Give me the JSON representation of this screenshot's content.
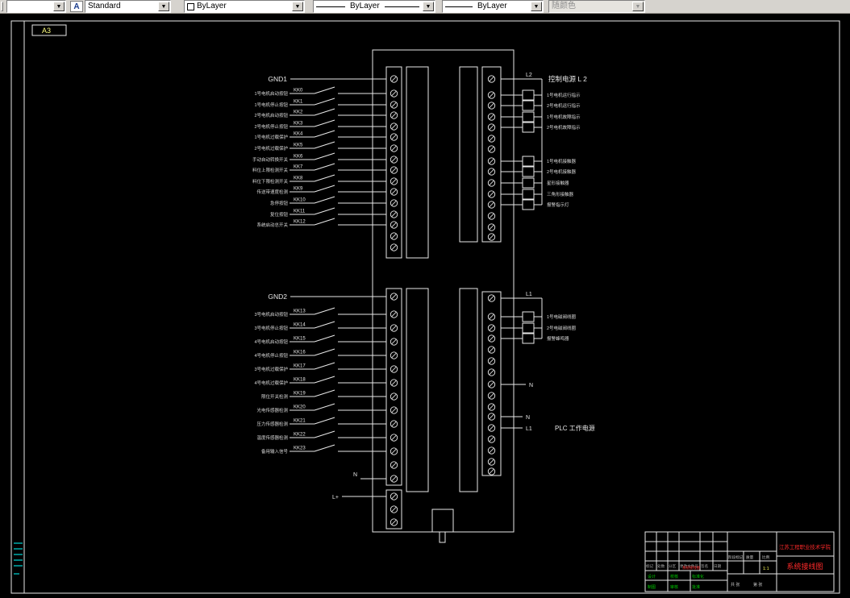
{
  "toolbar": {
    "layer_combo_value": "",
    "text_style_value": "Standard",
    "color_value": "ByLayer",
    "linetype_value": "ByLayer",
    "lineweight_value": "ByLayer",
    "plot_style_value": "随颜色"
  },
  "frame": {
    "format_label": "A3"
  },
  "diagram": {
    "gnd1_label": "GND1",
    "gnd2_label": "GND2",
    "l2_label": "L2",
    "l1_label": "L1",
    "n_label": "N",
    "lplus_label": "L+",
    "control_power_title": "控制电源 L 2",
    "plc_power_title": "PLC 工作电源",
    "top_inputs": [
      {
        "name": "KK0",
        "label": "1号电机启动按钮"
      },
      {
        "name": "KK1",
        "label": "1号电机停止按钮"
      },
      {
        "name": "KK2",
        "label": "2号电机启动按钮"
      },
      {
        "name": "KK3",
        "label": "2号电机停止按钮"
      },
      {
        "name": "KK4",
        "label": "1号电机过载保护"
      },
      {
        "name": "KK5",
        "label": "2号电机过载保护"
      },
      {
        "name": "KK6",
        "label": "手动自动转换开关"
      },
      {
        "name": "KK7",
        "label": "料位上限检测开关"
      },
      {
        "name": "KK8",
        "label": "料位下限检测开关"
      },
      {
        "name": "KK9",
        "label": "传送带速度检测"
      },
      {
        "name": "KK10",
        "label": "急停按钮"
      },
      {
        "name": "KK11",
        "label": "复位按钮"
      },
      {
        "name": "KK12",
        "label": "系统启动总开关"
      }
    ],
    "bottom_inputs": [
      {
        "name": "KK13",
        "label": "3号电机启动按钮"
      },
      {
        "name": "KK14",
        "label": "3号电机停止按钮"
      },
      {
        "name": "KK15",
        "label": "4号电机启动按钮"
      },
      {
        "name": "KK16",
        "label": "4号电机停止按钮"
      },
      {
        "name": "KK17",
        "label": "3号电机过载保护"
      },
      {
        "name": "KK18",
        "label": "4号电机过载保护"
      },
      {
        "name": "KK19",
        "label": "限位开关检测"
      },
      {
        "name": "KK20",
        "label": "光电传感器检测"
      },
      {
        "name": "KK21",
        "label": "压力传感器检测"
      },
      {
        "name": "KK22",
        "label": "温度传感器检测"
      },
      {
        "name": "KK23",
        "label": "备用输入信号"
      }
    ],
    "top_outputs": [
      {
        "label": "1号电机运行指示"
      },
      {
        "label": "2号电机运行指示"
      },
      {
        "label": "1号电机故障指示"
      },
      {
        "label": "2号电机故障指示"
      },
      {
        "label": "1号电机接触器"
      },
      {
        "label": "2号电机接触器"
      },
      {
        "label": "星形接触器"
      },
      {
        "label": "三角形接触器"
      },
      {
        "label": "报警指示灯"
      }
    ],
    "bottom_outputs": [
      {
        "label": "1号电磁阀线圈"
      },
      {
        "label": "2号电磁阀线圈"
      },
      {
        "label": "报警蜂鸣器"
      }
    ]
  },
  "titleblock": {
    "school": "江苏工程职业技术学院",
    "drawing_title": "系统接线图",
    "red_note": "系统接线图",
    "rev_headers": [
      "标记",
      "处数",
      "分区",
      "更改文件号",
      "签名",
      "日期"
    ],
    "roles": [
      "设计",
      "校核",
      "标准化",
      "制图",
      "审核",
      "批准"
    ],
    "stage_label": "阶段标记",
    "mass_label": "质量",
    "scale_label": "比例",
    "scale_value": "1:1",
    "sheet_total": "共 张",
    "sheet_no": "第 张"
  },
  "colors": {
    "wire": "#e8e8e8",
    "accent_red": "#ff2a2a",
    "accent_green": "#00c800",
    "accent_cyan": "#00ffff",
    "accent_yellow": "#ffff55",
    "format_label": "#ffff80"
  }
}
